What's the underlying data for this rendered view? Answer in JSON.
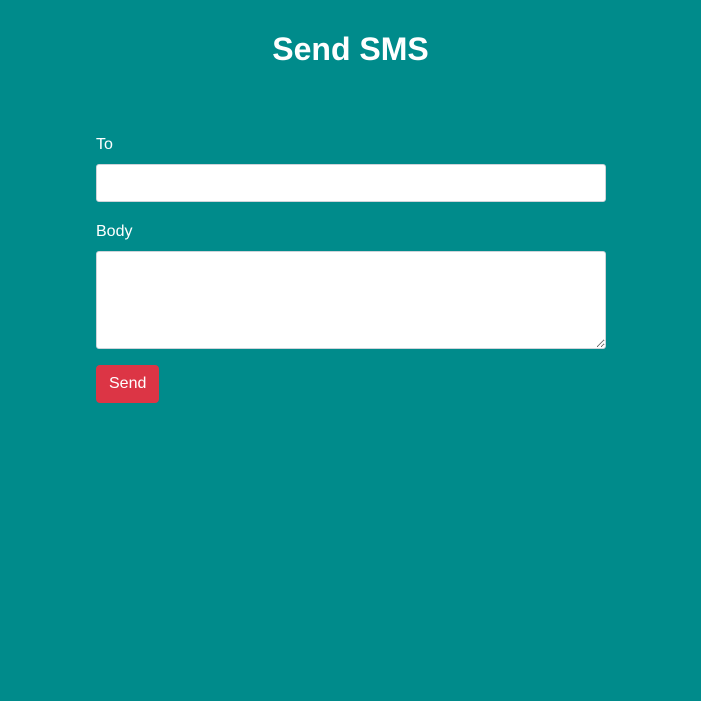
{
  "page": {
    "title": "Send SMS",
    "background_color": "#008b8b"
  },
  "form": {
    "to_label": "To",
    "to_value": "",
    "body_label": "Body",
    "body_value": "",
    "send_label": "Send",
    "send_color": "#dc3545"
  }
}
